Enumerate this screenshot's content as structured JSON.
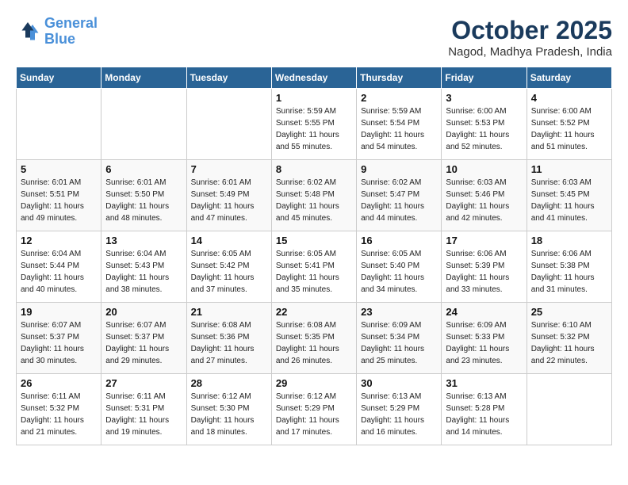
{
  "logo": {
    "line1": "General",
    "line2": "Blue"
  },
  "title": "October 2025",
  "location": "Nagod, Madhya Pradesh, India",
  "weekdays": [
    "Sunday",
    "Monday",
    "Tuesday",
    "Wednesday",
    "Thursday",
    "Friday",
    "Saturday"
  ],
  "weeks": [
    [
      null,
      null,
      null,
      {
        "day": 1,
        "sunrise": "Sunrise: 5:59 AM",
        "sunset": "Sunset: 5:55 PM",
        "daylight": "Daylight: 11 hours and 55 minutes."
      },
      {
        "day": 2,
        "sunrise": "Sunrise: 5:59 AM",
        "sunset": "Sunset: 5:54 PM",
        "daylight": "Daylight: 11 hours and 54 minutes."
      },
      {
        "day": 3,
        "sunrise": "Sunrise: 6:00 AM",
        "sunset": "Sunset: 5:53 PM",
        "daylight": "Daylight: 11 hours and 52 minutes."
      },
      {
        "day": 4,
        "sunrise": "Sunrise: 6:00 AM",
        "sunset": "Sunset: 5:52 PM",
        "daylight": "Daylight: 11 hours and 51 minutes."
      }
    ],
    [
      {
        "day": 5,
        "sunrise": "Sunrise: 6:01 AM",
        "sunset": "Sunset: 5:51 PM",
        "daylight": "Daylight: 11 hours and 49 minutes."
      },
      {
        "day": 6,
        "sunrise": "Sunrise: 6:01 AM",
        "sunset": "Sunset: 5:50 PM",
        "daylight": "Daylight: 11 hours and 48 minutes."
      },
      {
        "day": 7,
        "sunrise": "Sunrise: 6:01 AM",
        "sunset": "Sunset: 5:49 PM",
        "daylight": "Daylight: 11 hours and 47 minutes."
      },
      {
        "day": 8,
        "sunrise": "Sunrise: 6:02 AM",
        "sunset": "Sunset: 5:48 PM",
        "daylight": "Daylight: 11 hours and 45 minutes."
      },
      {
        "day": 9,
        "sunrise": "Sunrise: 6:02 AM",
        "sunset": "Sunset: 5:47 PM",
        "daylight": "Daylight: 11 hours and 44 minutes."
      },
      {
        "day": 10,
        "sunrise": "Sunrise: 6:03 AM",
        "sunset": "Sunset: 5:46 PM",
        "daylight": "Daylight: 11 hours and 42 minutes."
      },
      {
        "day": 11,
        "sunrise": "Sunrise: 6:03 AM",
        "sunset": "Sunset: 5:45 PM",
        "daylight": "Daylight: 11 hours and 41 minutes."
      }
    ],
    [
      {
        "day": 12,
        "sunrise": "Sunrise: 6:04 AM",
        "sunset": "Sunset: 5:44 PM",
        "daylight": "Daylight: 11 hours and 40 minutes."
      },
      {
        "day": 13,
        "sunrise": "Sunrise: 6:04 AM",
        "sunset": "Sunset: 5:43 PM",
        "daylight": "Daylight: 11 hours and 38 minutes."
      },
      {
        "day": 14,
        "sunrise": "Sunrise: 6:05 AM",
        "sunset": "Sunset: 5:42 PM",
        "daylight": "Daylight: 11 hours and 37 minutes."
      },
      {
        "day": 15,
        "sunrise": "Sunrise: 6:05 AM",
        "sunset": "Sunset: 5:41 PM",
        "daylight": "Daylight: 11 hours and 35 minutes."
      },
      {
        "day": 16,
        "sunrise": "Sunrise: 6:05 AM",
        "sunset": "Sunset: 5:40 PM",
        "daylight": "Daylight: 11 hours and 34 minutes."
      },
      {
        "day": 17,
        "sunrise": "Sunrise: 6:06 AM",
        "sunset": "Sunset: 5:39 PM",
        "daylight": "Daylight: 11 hours and 33 minutes."
      },
      {
        "day": 18,
        "sunrise": "Sunrise: 6:06 AM",
        "sunset": "Sunset: 5:38 PM",
        "daylight": "Daylight: 11 hours and 31 minutes."
      }
    ],
    [
      {
        "day": 19,
        "sunrise": "Sunrise: 6:07 AM",
        "sunset": "Sunset: 5:37 PM",
        "daylight": "Daylight: 11 hours and 30 minutes."
      },
      {
        "day": 20,
        "sunrise": "Sunrise: 6:07 AM",
        "sunset": "Sunset: 5:37 PM",
        "daylight": "Daylight: 11 hours and 29 minutes."
      },
      {
        "day": 21,
        "sunrise": "Sunrise: 6:08 AM",
        "sunset": "Sunset: 5:36 PM",
        "daylight": "Daylight: 11 hours and 27 minutes."
      },
      {
        "day": 22,
        "sunrise": "Sunrise: 6:08 AM",
        "sunset": "Sunset: 5:35 PM",
        "daylight": "Daylight: 11 hours and 26 minutes."
      },
      {
        "day": 23,
        "sunrise": "Sunrise: 6:09 AM",
        "sunset": "Sunset: 5:34 PM",
        "daylight": "Daylight: 11 hours and 25 minutes."
      },
      {
        "day": 24,
        "sunrise": "Sunrise: 6:09 AM",
        "sunset": "Sunset: 5:33 PM",
        "daylight": "Daylight: 11 hours and 23 minutes."
      },
      {
        "day": 25,
        "sunrise": "Sunrise: 6:10 AM",
        "sunset": "Sunset: 5:32 PM",
        "daylight": "Daylight: 11 hours and 22 minutes."
      }
    ],
    [
      {
        "day": 26,
        "sunrise": "Sunrise: 6:11 AM",
        "sunset": "Sunset: 5:32 PM",
        "daylight": "Daylight: 11 hours and 21 minutes."
      },
      {
        "day": 27,
        "sunrise": "Sunrise: 6:11 AM",
        "sunset": "Sunset: 5:31 PM",
        "daylight": "Daylight: 11 hours and 19 minutes."
      },
      {
        "day": 28,
        "sunrise": "Sunrise: 6:12 AM",
        "sunset": "Sunset: 5:30 PM",
        "daylight": "Daylight: 11 hours and 18 minutes."
      },
      {
        "day": 29,
        "sunrise": "Sunrise: 6:12 AM",
        "sunset": "Sunset: 5:29 PM",
        "daylight": "Daylight: 11 hours and 17 minutes."
      },
      {
        "day": 30,
        "sunrise": "Sunrise: 6:13 AM",
        "sunset": "Sunset: 5:29 PM",
        "daylight": "Daylight: 11 hours and 16 minutes."
      },
      {
        "day": 31,
        "sunrise": "Sunrise: 6:13 AM",
        "sunset": "Sunset: 5:28 PM",
        "daylight": "Daylight: 11 hours and 14 minutes."
      },
      null
    ]
  ]
}
